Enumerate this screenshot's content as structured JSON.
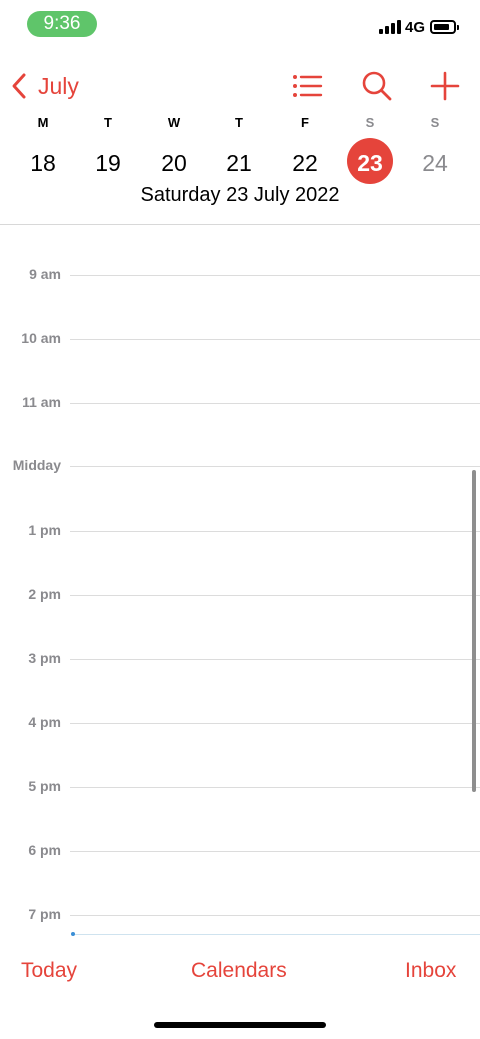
{
  "status_bar": {
    "time": "9:36",
    "network": "4G",
    "time_pill_color": "#5fc56a"
  },
  "nav": {
    "back_label": "July",
    "icons": [
      "chevron-left-icon",
      "list-icon",
      "search-icon",
      "plus-icon"
    ],
    "accent_color": "#e5443b"
  },
  "week": {
    "days": [
      {
        "dow": "M",
        "date": "18"
      },
      {
        "dow": "T",
        "date": "19"
      },
      {
        "dow": "W",
        "date": "20"
      },
      {
        "dow": "T",
        "date": "21"
      },
      {
        "dow": "F",
        "date": "22"
      },
      {
        "dow": "S",
        "date": "23"
      },
      {
        "dow": "S",
        "date": "24"
      }
    ],
    "selected_date": "23",
    "selected_title": "Saturday  23 July 2022"
  },
  "hours": [
    "9 am",
    "10 am",
    "11 am",
    "Midday",
    "1 pm",
    "2 pm",
    "3 pm",
    "4 pm",
    "5 pm",
    "6 pm",
    "7 pm"
  ],
  "tabbar": {
    "today": "Today",
    "calendars": "Calendars",
    "inbox": "Inbox"
  }
}
